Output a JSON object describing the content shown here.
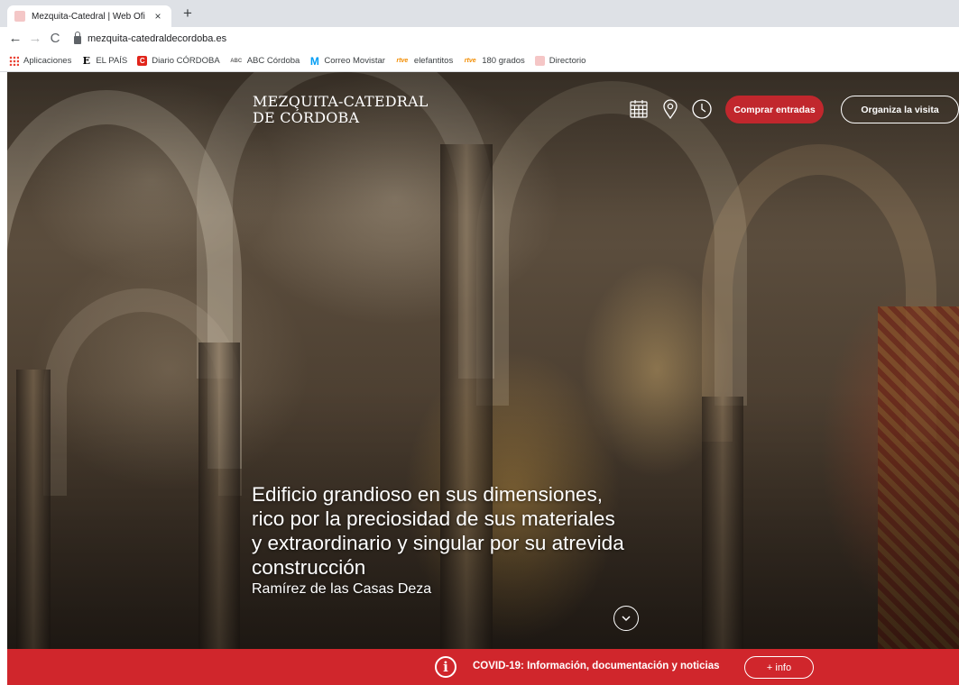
{
  "browser": {
    "tab_title": "Mezquita-Catedral | Web Oficial",
    "tab_close": "×",
    "new_tab": "+",
    "back": "←",
    "forward": "→",
    "reload": "C",
    "url": "mezquita-catedraldecordoba.es",
    "bookmarks": [
      {
        "label": "Aplicaciones",
        "icon": "apps-grid-icon"
      },
      {
        "label": "EL PAÍS",
        "icon": "elpais-icon",
        "glyph": "E"
      },
      {
        "label": "Diario CÓRDOBA",
        "icon": "diario-cordoba-icon",
        "glyph": "C"
      },
      {
        "label": "ABC Córdoba",
        "icon": "abc-icon",
        "glyph": "ABC"
      },
      {
        "label": "Correo Movistar",
        "icon": "movistar-icon",
        "glyph": "M"
      },
      {
        "label": "elefantitos",
        "icon": "rtve-icon",
        "glyph": "rtve"
      },
      {
        "label": "180 grados",
        "icon": "rtve-icon",
        "glyph": "rtve"
      },
      {
        "label": "Directorio",
        "icon": "folder-icon"
      }
    ]
  },
  "site": {
    "logo_line1": "MEZQUITA-CATEDRAL",
    "logo_line2": "DE CÓRDOBA",
    "header_icons": [
      "calendar-icon",
      "location-pin-icon",
      "clock-icon"
    ],
    "buy_button": "Comprar entradas",
    "visit_button": "Organiza la visita",
    "accent_color": "#c1272d"
  },
  "hero": {
    "quote": "Edificio grandioso en sus dimensiones, rico por la preciosidad de sus materiales y extraordinario y singular por su atrevida construcción",
    "author": "Ramírez de las Casas Deza",
    "scroll_icon": "chevron-down-circle-icon"
  },
  "covid_bar": {
    "icon": "info-icon",
    "info_glyph": "i",
    "text": "COVID-19: Información, documentación y noticias",
    "button": "+ info",
    "color": "#d0262c"
  }
}
